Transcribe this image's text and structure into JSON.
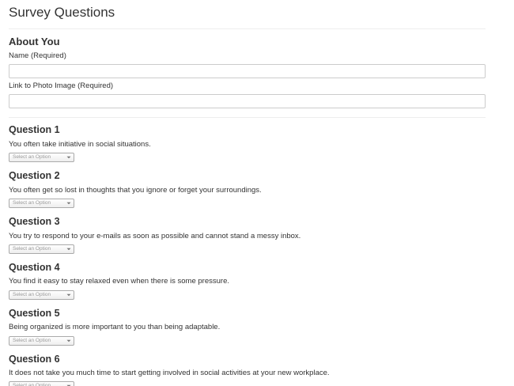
{
  "page_title": "Survey Questions",
  "about": {
    "heading": "About You",
    "name_label": "Name (Required)",
    "name_value": "",
    "photo_label": "Link to Photo Image (Required)",
    "photo_value": ""
  },
  "select_placeholder": "Select an Option",
  "questions": [
    {
      "title": "Question 1",
      "text": "You often take initiative in social situations."
    },
    {
      "title": "Question 2",
      "text": "You often get so lost in thoughts that you ignore or forget your surroundings."
    },
    {
      "title": "Question 3",
      "text": "You try to respond to your e-mails as soon as possible and cannot stand a messy inbox."
    },
    {
      "title": "Question 4",
      "text": "You find it easy to stay relaxed even when there is some pressure."
    },
    {
      "title": "Question 5",
      "text": "Being organized is more important to you than being adaptable."
    },
    {
      "title": "Question 6",
      "text": "It does not take you much time to start getting involved in social activities at your new workplace."
    }
  ],
  "colors": {
    "text": "#333333",
    "divider": "#eeeeee",
    "input_border": "#cccccc",
    "select_border": "#aaaaaa",
    "placeholder": "#999999"
  }
}
